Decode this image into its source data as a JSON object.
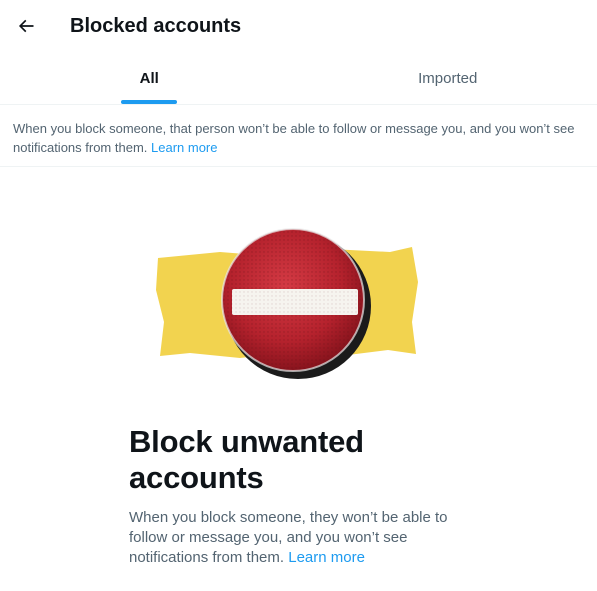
{
  "header": {
    "back_icon": "arrow-left-icon",
    "title": "Blocked accounts"
  },
  "tabs": [
    {
      "label": "All",
      "active": true
    },
    {
      "label": "Imported",
      "active": false
    }
  ],
  "info": {
    "text": "When you block someone, that person won’t be able to follow or message you, and you won’t see notifications from them.",
    "link": "Learn more"
  },
  "illustration": {
    "name": "no-entry-sign-icon",
    "sign_color": "#c4202f",
    "tape_color": "#f2d34f"
  },
  "empty_state": {
    "title": "Block unwanted accounts",
    "description": "When you block someone, they won’t be able to follow or message you, and you won’t see notifications from them.",
    "link": "Learn more"
  },
  "colors": {
    "accent": "#1d9bf0",
    "text_primary": "#0f1419",
    "text_secondary": "#536471"
  }
}
